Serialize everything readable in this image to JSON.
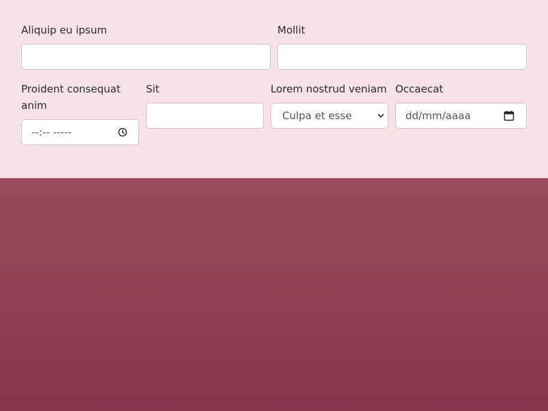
{
  "form": {
    "field1": {
      "label": "Aliquip eu ipsum",
      "value": ""
    },
    "field2": {
      "label": "Mollit",
      "value": ""
    },
    "field3": {
      "label": "Proident consequat anim",
      "placeholder": "--:-- -----"
    },
    "field4": {
      "label": "Sit",
      "value": ""
    },
    "field5": {
      "label": "Lorem nostrud veniam",
      "selected": "Culpa et esse"
    },
    "field6": {
      "label": "Occaecat",
      "placeholder": "dd/mm/aaaa"
    }
  },
  "icons": {
    "time": "clock-icon",
    "date": "calendar-icon",
    "select": "chevron-down-icon"
  },
  "colors": {
    "form_background": "#f7e2e6",
    "bottom_background": "#8e3a50",
    "input_border": "#cfc6c8"
  }
}
